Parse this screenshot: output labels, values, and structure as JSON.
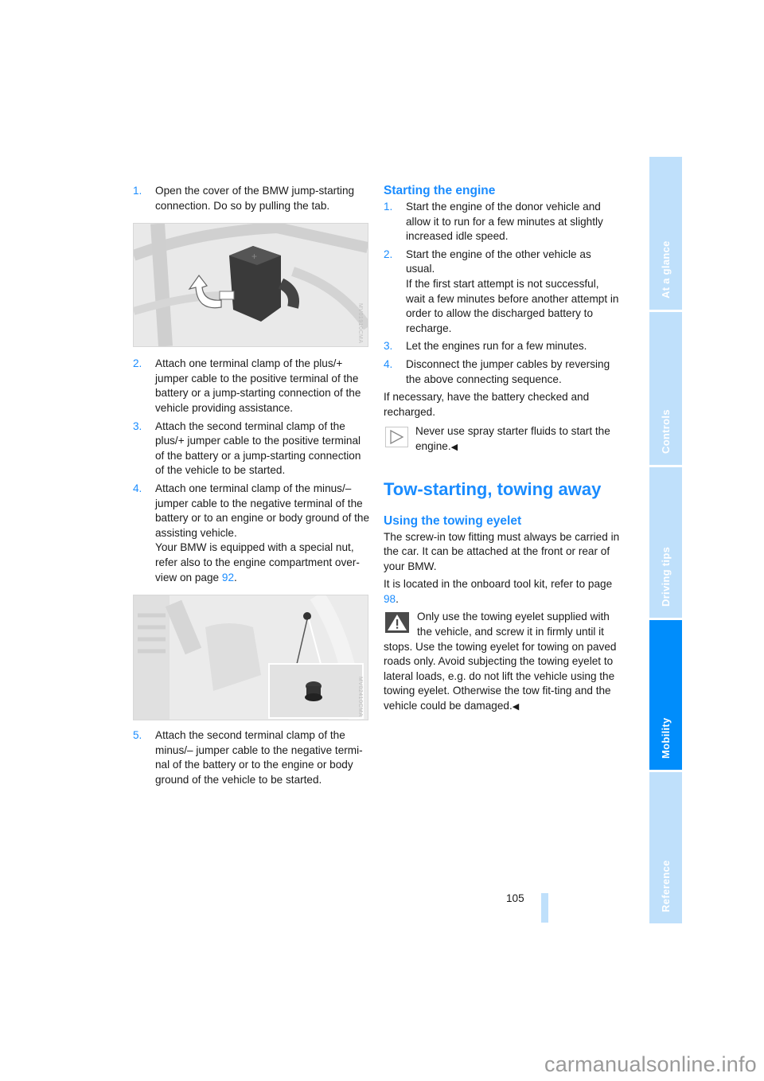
{
  "left_column": {
    "steps": [
      {
        "num": "1.",
        "text": "Open the cover of the BMW jump-starting connection. Do so by pulling the tab."
      },
      {
        "num": "2.",
        "text": "Attach one terminal clamp of the plus/+ jumper cable to the positive terminal of the battery or a jump-starting connection of the vehicle providing assistance."
      },
      {
        "num": "3.",
        "text": "Attach the second terminal clamp of the plus/+ jumper cable to the positive terminal of the battery or a jump-starting connection of the vehicle to be started."
      },
      {
        "num": "4.",
        "text": "Attach one terminal clamp of the minus/– jumper cable to the negative terminal of the battery or to an engine or body ground of the assisting vehicle.",
        "extra": "Your BMW is equipped with a special nut, refer also to the engine compartment over-view on page ",
        "extra_link": "92",
        "extra_end": "."
      },
      {
        "num": "5.",
        "text": "Attach the second terminal clamp of the minus/– jumper cable to the negative termi-nal of the battery or to the engine or body ground of the vehicle to be started."
      }
    ],
    "figure1": {
      "alt": "Jump-starting connection cover with arrow showing tab pull",
      "code": "MV01910CMA"
    },
    "figure2": {
      "alt": "Engine compartment with special ground nut detail",
      "code": "MV02410CMA"
    }
  },
  "right_column": {
    "section_heading": "Starting the engine",
    "steps": [
      {
        "num": "1.",
        "text": "Start the engine of the donor vehicle and allow it to run for a few minutes at slightly increased idle speed."
      },
      {
        "num": "2.",
        "text": "Start the engine of the other vehicle as usual.",
        "extra": "If the first start attempt is not successful, wait a few minutes before another attempt in order to allow the discharged battery to recharge."
      },
      {
        "num": "3.",
        "text": "Let the engines run for a few minutes."
      },
      {
        "num": "4.",
        "text": "Disconnect the jumper cables by reversing the above connecting sequence."
      }
    ],
    "after_steps": "If necessary, have the battery checked and recharged.",
    "note": "Never use spray starter fluids to start the engine.",
    "end_mark": "◀",
    "chapter_heading": "Tow-starting, towing away",
    "sub_heading": "Using the towing eyelet",
    "para1": "The screw-in tow fitting must always be carried in the car. It can be attached at the front or rear of your BMW.",
    "para2_text": "It is located in the onboard tool kit, refer to page ",
    "para2_link": "98",
    "para2_end": ".",
    "warning": "Only use the towing eyelet supplied with the vehicle, and screw it in firmly until it stops. Use the towing eyelet for towing on paved roads only. Avoid subjecting the towing eyelet to lateral loads, e.g. do not lift the vehicle using the towing eyelet. Otherwise the tow fit-ting and the vehicle could be damaged."
  },
  "sidebar_tabs": [
    {
      "label": "At a glance",
      "active": false
    },
    {
      "label": "Controls",
      "active": false
    },
    {
      "label": "Driving tips",
      "active": false
    },
    {
      "label": "Mobility",
      "active": true
    },
    {
      "label": "Reference",
      "active": false
    }
  ],
  "page_number": "105",
  "watermark": "carmanualsonline.info",
  "colors": {
    "accent": "#1a8cff",
    "tab_active": "#008dfb",
    "tab_inactive": "#bfe0fb"
  }
}
